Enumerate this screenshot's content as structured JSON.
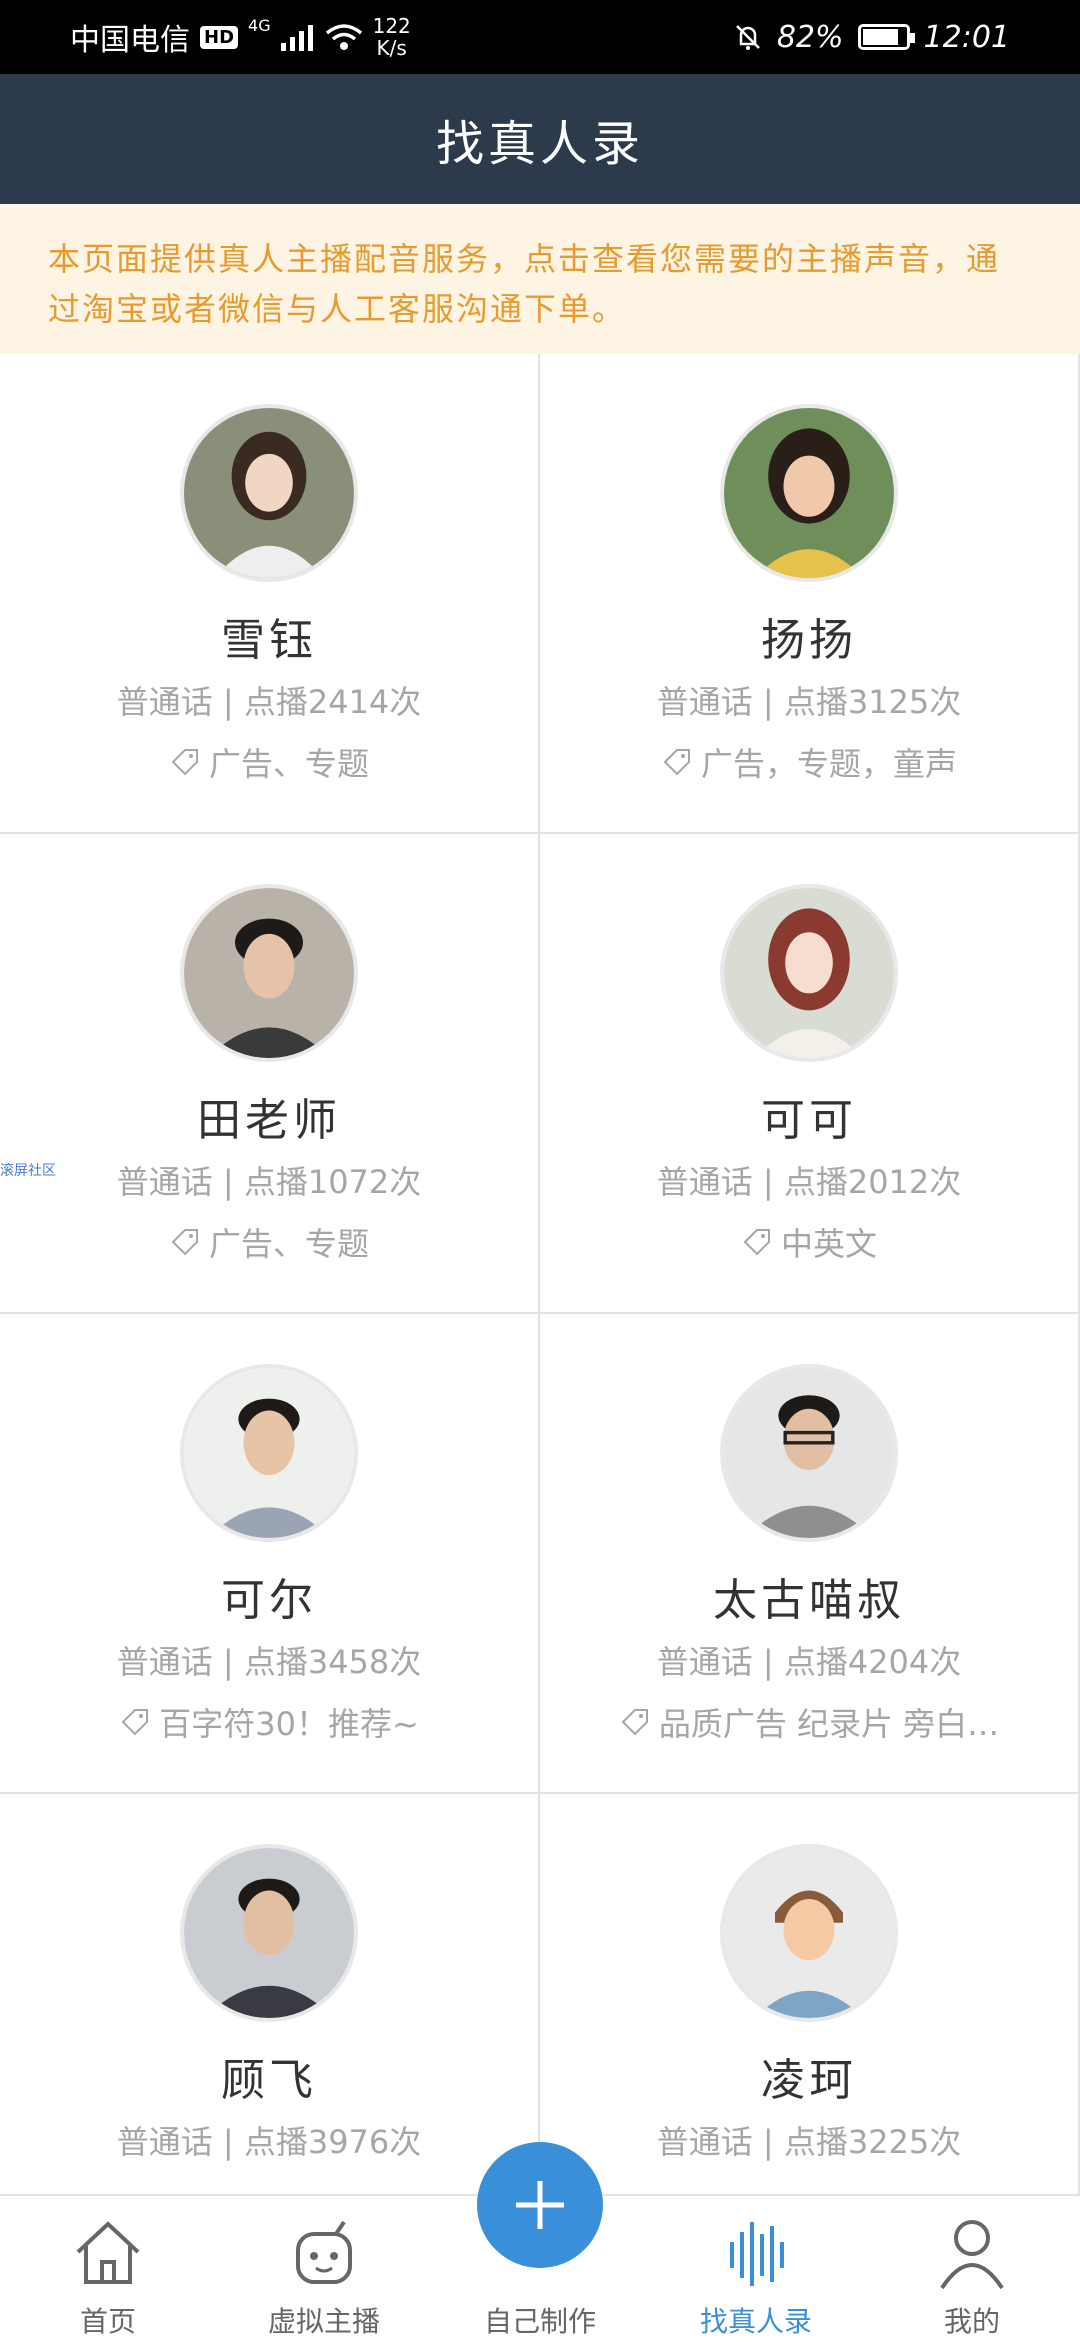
{
  "status_bar": {
    "carrier": "中国电信",
    "hd": "HD",
    "network": "4G",
    "speed_value": "122",
    "speed_unit": "K/s",
    "battery": "82%",
    "time": "12:01"
  },
  "header": {
    "title": "找真人录"
  },
  "notice": {
    "text": "本页面提供真人主播配音服务，点击查看您需要的主播声音，通过淘宝或者微信与人工客服沟通下单。"
  },
  "hosts": [
    {
      "name": "雪钰",
      "meta": "普通话 | 点播2414次",
      "tags": "广告、专题"
    },
    {
      "name": "扬扬",
      "meta": "普通话 | 点播3125次",
      "tags": "广告，专题，童声"
    },
    {
      "name": "田老师",
      "meta": "普通话 | 点播1072次",
      "tags": "广告、专题"
    },
    {
      "name": "可可",
      "meta": "普通话 | 点播2012次",
      "tags": "中英文"
    },
    {
      "name": "可尔",
      "meta": "普通话 | 点播3458次",
      "tags": "百字符30！推荐~"
    },
    {
      "name": "太古喵叔",
      "meta": "普通话 | 点播4204次",
      "tags": "品质广告 纪录片 旁白…"
    },
    {
      "name": "顾飞",
      "meta": "普通话 | 点播3976次",
      "tags": ""
    },
    {
      "name": "凌珂",
      "meta": "普通话 | 点播3225次",
      "tags": ""
    }
  ],
  "side_watermark": "滚屏社区",
  "tab_bar": {
    "tabs": [
      {
        "label": "首页",
        "icon": "home-icon"
      },
      {
        "label": "虚拟主播",
        "icon": "robot-icon"
      },
      {
        "label": "自己制作",
        "icon": "plus-icon"
      },
      {
        "label": "找真人录",
        "icon": "sound-wave-icon"
      },
      {
        "label": "我的",
        "icon": "person-icon"
      }
    ],
    "active_index": 3
  },
  "colors": {
    "nav_bg": "#2c3a4c",
    "notice_bg": "#fdf4e3",
    "notice_text": "#e79a2e",
    "accent": "#3a8fd9"
  }
}
